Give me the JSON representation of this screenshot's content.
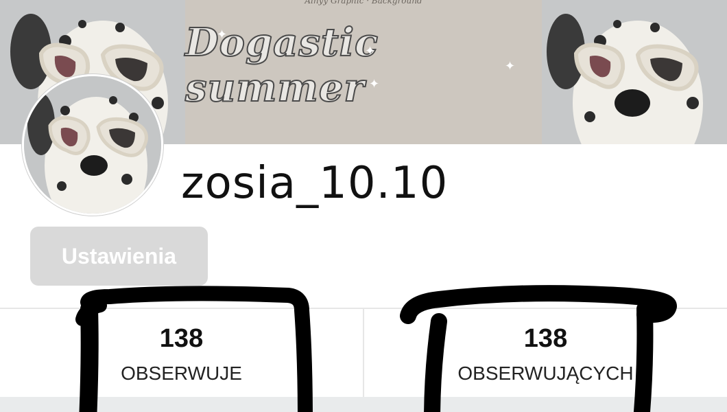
{
  "banner": {
    "credits": "Ainyy Graphic · Background",
    "title": "Dogastic summer"
  },
  "profile": {
    "username": "zosia_10.10",
    "settings_label": "Ustawienia"
  },
  "stats": [
    {
      "count": "138",
      "label": "OBSERWUJE"
    },
    {
      "count": "138",
      "label": "OBSERWUJĄCYCH"
    }
  ],
  "colors": {
    "banner_center": "#cdc7bf",
    "button_bg": "#d9d9d9",
    "divider": "#e6e6e6",
    "scribble": "#000000"
  }
}
